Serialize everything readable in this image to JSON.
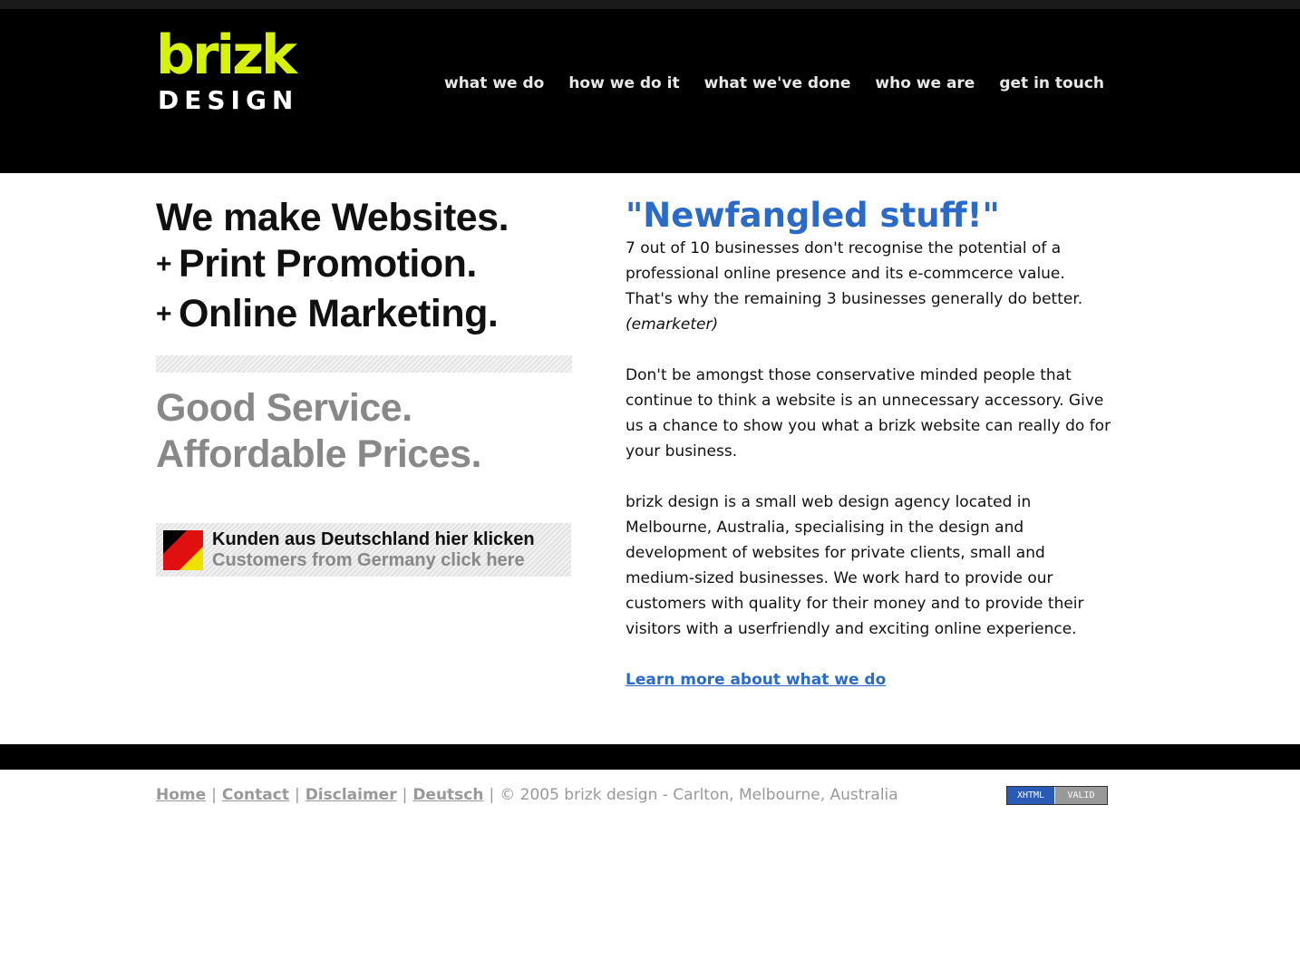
{
  "header": {
    "logo_top": "brizk",
    "logo_bottom": "DESIGN",
    "nav": [
      {
        "label": "what we do"
      },
      {
        "label": "how we do it"
      },
      {
        "label": "what we've done"
      },
      {
        "label": "who we are"
      },
      {
        "label": "get in touch"
      }
    ]
  },
  "left": {
    "tagline_line1": "We make Websites.",
    "tagline_line2": "Print Promotion.",
    "tagline_line3": "Online Marketing.",
    "plus": "+",
    "service_line1": "Good Service.",
    "service_line2": "Affordable Prices.",
    "germany_de": "Kunden aus Deutschland hier klicken",
    "germany_en": "Customers from Germany click here",
    "flag_colors": [
      "#000000",
      "#e01010",
      "#f0e000"
    ]
  },
  "main": {
    "headline": "\"Newfangled stuff!\"",
    "para1": "7 out of 10 businesses don't recognise the potential of a professional online presence and its e-commcerce value. That's why the remaining 3 businesses generally do better.",
    "para1_source": "(emarketer)",
    "para2": "Don't be amongst those conservative minded people that continue to think a website is an unnecessary accessory. Give us a chance to show you what a brizk website can really do for your business.",
    "para3": "brizk design is a small web design agency located in Melbourne, Australia, specialising in the design and development of websites for private clients, small and medium-sized businesses. We work hard to provide our customers with quality for their money and to provide their visitors with a userfriendly and exciting online experience.",
    "learn_more": "Learn more about what we do"
  },
  "footer": {
    "links": [
      "Home",
      "Contact",
      "Disclaimer",
      "Deutsch"
    ],
    "separator": "|",
    "copyright": "© 2005 brizk design - Carlton, Melbourne, Australia",
    "badge_left": "XHTML",
    "badge_right": "VALID"
  },
  "colors": {
    "accent": "#2a6ac8",
    "logo_green": "#d6f20b",
    "header_bg": "#000000"
  }
}
